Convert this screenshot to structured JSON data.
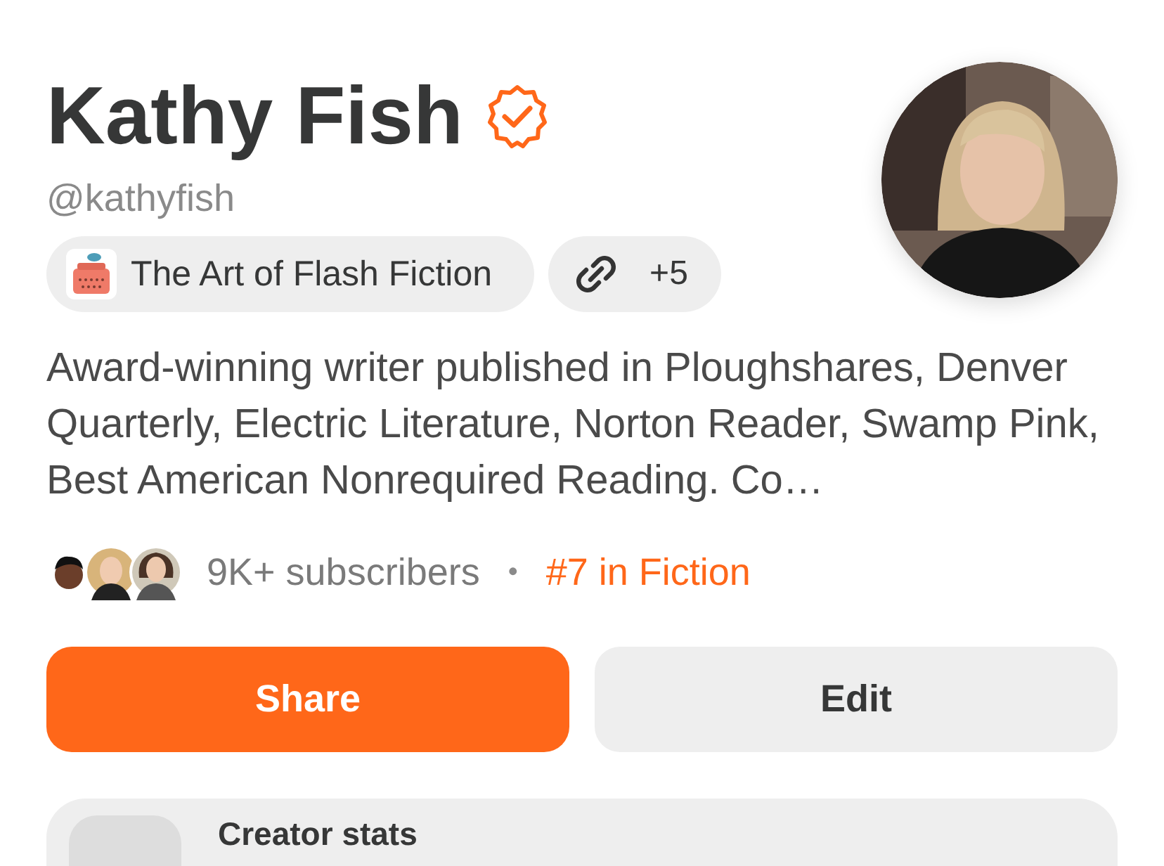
{
  "profile": {
    "name": "Kathy Fish",
    "verified": true,
    "handle": "@kathyfish"
  },
  "chips": [
    {
      "kind": "publication",
      "label": "The Art of Flash Fiction"
    },
    {
      "kind": "links",
      "label": "+5"
    }
  ],
  "bio": "Award-winning writer published in Ploughshares, Denver Quarterly, Electric Literature, Norton Reader, Swamp Pink, Best American Nonrequired Reading. Co…",
  "stats": {
    "subscribers": "9K+ subscribers",
    "separator": "•",
    "rank": "#7 in Fiction"
  },
  "buttons": [
    {
      "label": "Share",
      "kind": "primary"
    },
    {
      "label": "Edit",
      "kind": "secondary"
    }
  ],
  "card": {
    "title": "Creator stats"
  }
}
